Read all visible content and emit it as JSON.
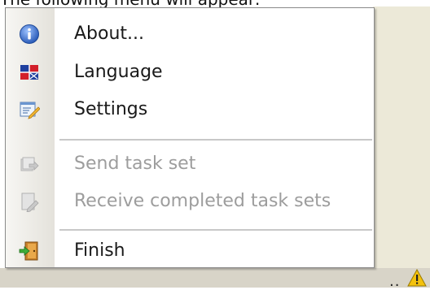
{
  "caption": "The following menu will appear:",
  "menu": {
    "items": [
      {
        "label": "About...",
        "icon": "info-icon",
        "enabled": true
      },
      {
        "label": "Language",
        "icon": "language-flag-icon",
        "enabled": true
      },
      {
        "label": "Settings",
        "icon": "settings-icon",
        "enabled": true
      },
      {
        "label": "Send task set",
        "icon": "send-task-set-icon",
        "enabled": false
      },
      {
        "label": "Receive completed task sets",
        "icon": "receive-task-sets-icon",
        "enabled": false
      },
      {
        "label": "Finish",
        "icon": "exit-door-icon",
        "enabled": true
      }
    ]
  },
  "tray": {
    "dots": "..",
    "warning_icon": "warning-icon"
  },
  "colors": {
    "enabled_text": "#1a1a1a",
    "disabled_text": "#9d9d9d",
    "separator": "#c8c8c8",
    "info_blue": "#3d6fc6",
    "warning_yellow": "#f4c20d"
  }
}
